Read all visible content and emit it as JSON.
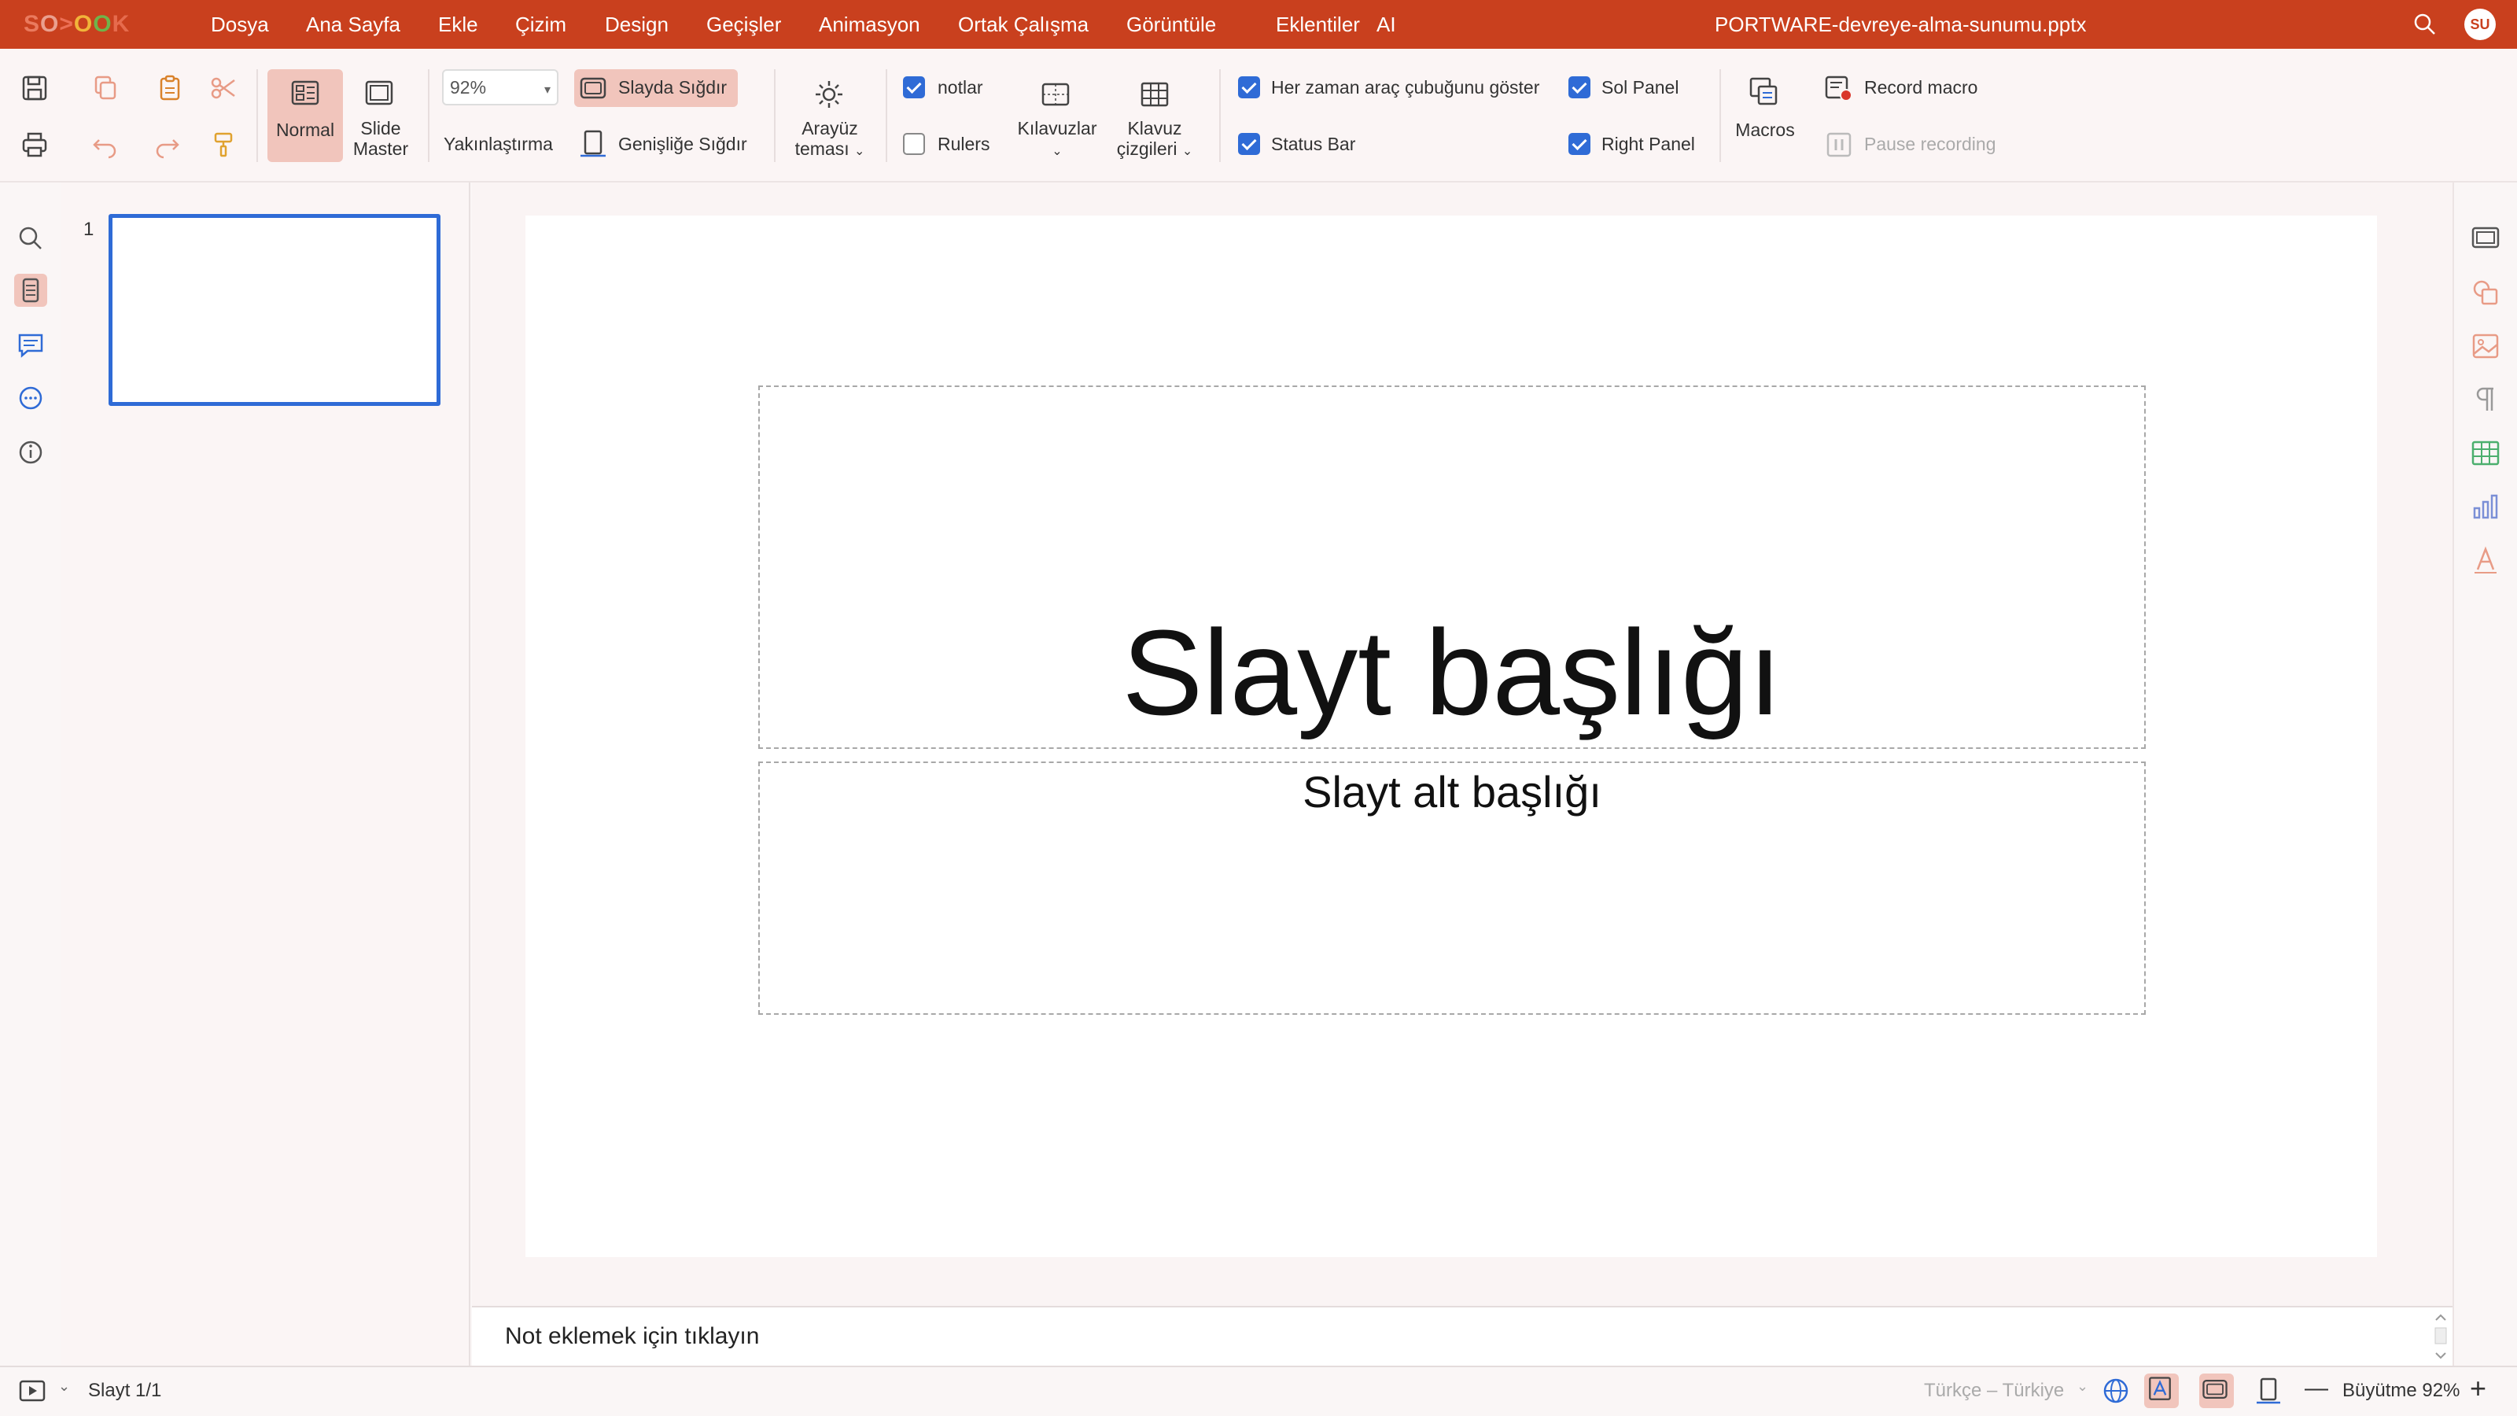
{
  "app": {
    "logo": "SO>OOK",
    "doc_title": "PORTWARE-devreye-alma-sunumu.pptx",
    "user_initials": "SU",
    "accent_color": "#c9401e"
  },
  "menu": [
    "Dosya",
    "Ana Sayfa",
    "Ekle",
    "Çizim",
    "Design",
    "Geçişler",
    "Animasyon",
    "Ortak Çalışma",
    "Görüntüle",
    "Eklentiler",
    "AI"
  ],
  "ribbon": {
    "normal_label": "Normal",
    "slide_master_label": [
      "Slide",
      "Master"
    ],
    "zoom_value": "92%",
    "zoom_label": "Yakınlaştırma",
    "fit_slide_label": "Slayda Sığdır",
    "fit_width_label": "Genişliğe Sığdır",
    "theme_label": [
      "Arayüz",
      "teması"
    ],
    "notes_label": "notlar",
    "rulers_label": "Rulers",
    "guides_label": "Kılavuzlar",
    "gridlines_label": [
      "Klavuz",
      "çizgileri"
    ],
    "always_toolbar_label": "Her zaman araç çubuğunu göster",
    "status_bar_label": "Status Bar",
    "left_panel_label": "Sol Panel",
    "right_panel_label": "Right Panel",
    "macros_label": "Macros",
    "record_macro_label": "Record macro",
    "pause_recording_label": "Pause recording",
    "checks": {
      "notes": true,
      "rulers": false,
      "always_toolbar": true,
      "status_bar": true,
      "left_panel": true,
      "right_panel": true
    }
  },
  "slides": {
    "thumb_number": "1"
  },
  "slide": {
    "title": "Slayt başlığı",
    "subtitle": "Slayt alt başlığı"
  },
  "notes": {
    "placeholder": "Not eklemek için tıklayın"
  },
  "status": {
    "slide_counter": "Slayt 1/1",
    "language": "Türkçe – Türkiye",
    "zoom_label": "Büyütme 92%"
  }
}
